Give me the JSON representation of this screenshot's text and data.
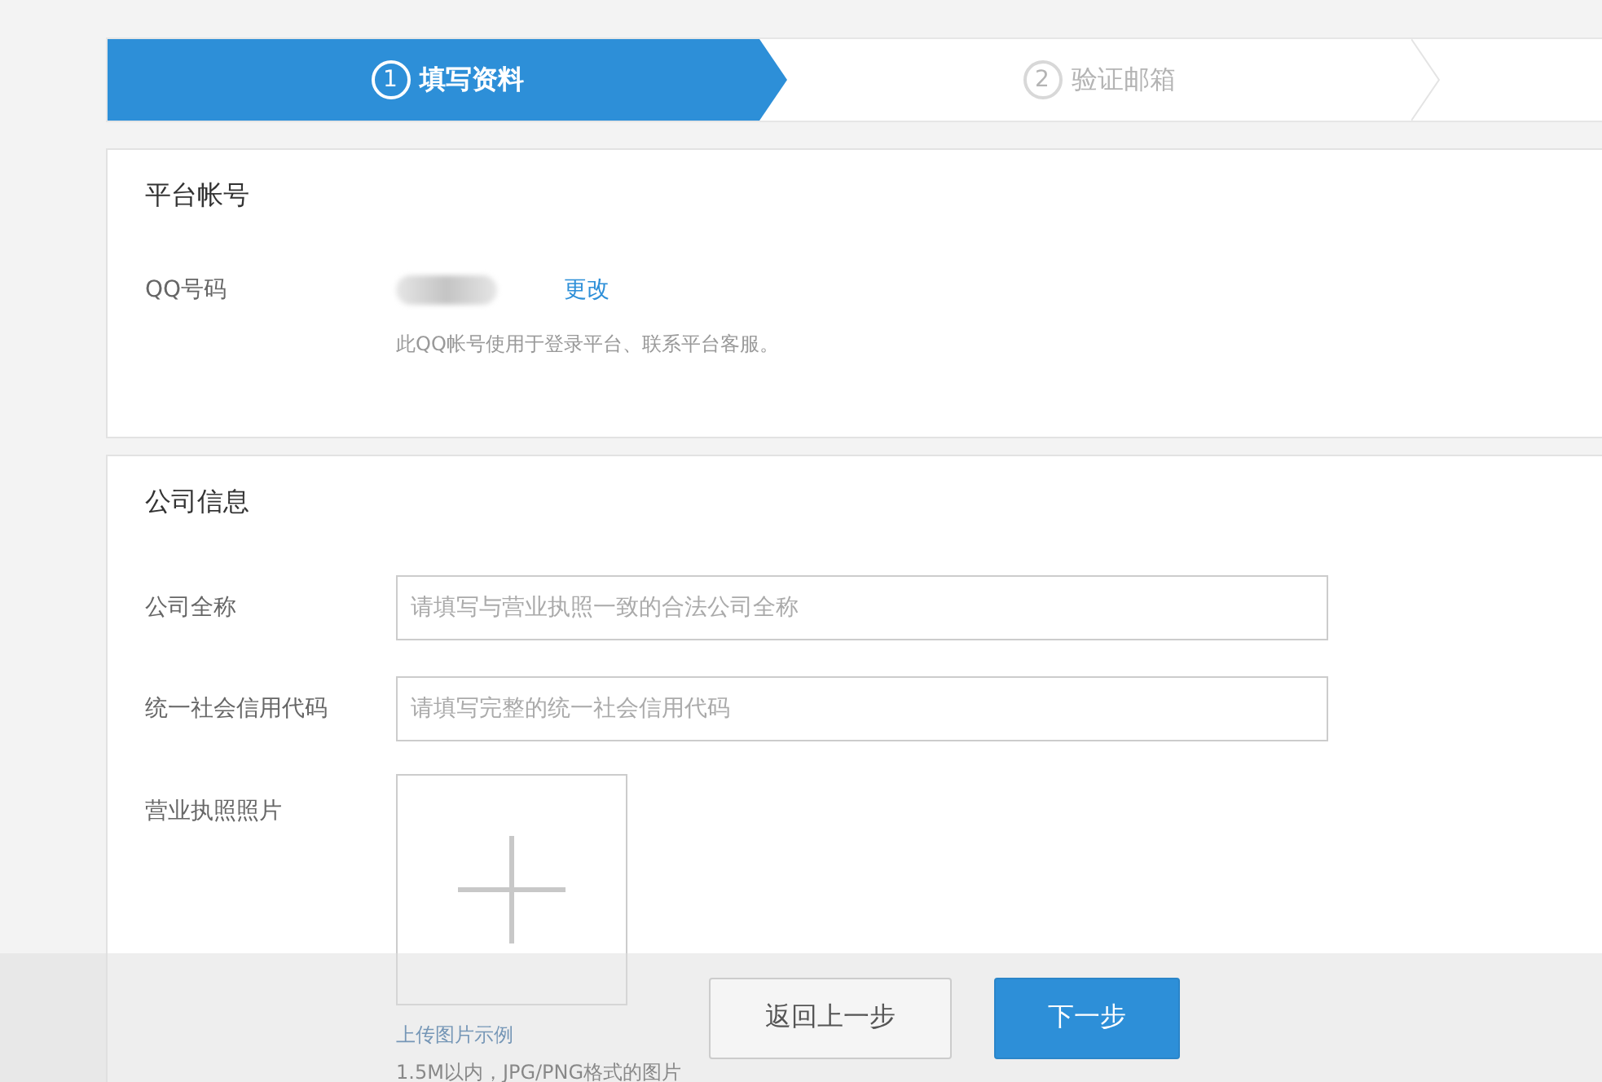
{
  "steps": [
    {
      "number": "1",
      "label": "填写资料",
      "selected": true
    },
    {
      "number": "2",
      "label": "验证邮箱",
      "selected": false
    }
  ],
  "platform_account": {
    "title": "平台帐号",
    "qq_label": "QQ号码",
    "change_link": "更改",
    "hint": "此QQ帐号使用于登录平台、联系平台客服。"
  },
  "company_info": {
    "title": "公司信息",
    "fields": [
      {
        "label": "公司全称",
        "placeholder": "请填写与营业执照一致的合法公司全称"
      },
      {
        "label": "统一社会信用代码",
        "placeholder": "请填写完整的统一社会信用代码"
      }
    ],
    "license": {
      "label": "营业执照照片",
      "example_link": "上传图片示例",
      "hint": "1.5M以内，JPG/PNG格式的图片"
    }
  },
  "footer": {
    "buttons": [
      {
        "label": "返回上一步",
        "kind": "secondary"
      },
      {
        "label": "下一步",
        "kind": "primary"
      }
    ]
  }
}
